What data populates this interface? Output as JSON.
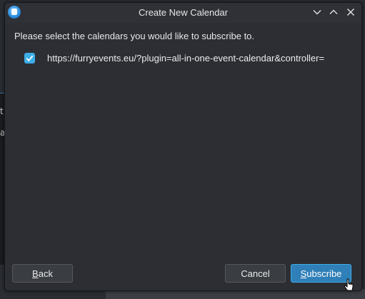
{
  "window": {
    "title": "Create New Calendar"
  },
  "titlebar_buttons": {
    "minimize_icon": "chevron-down-icon",
    "maximize_icon": "chevron-up-icon",
    "close_icon": "close-icon"
  },
  "dialog": {
    "instruction": "Please select the calendars you would like to subscribe to.",
    "calendars": [
      {
        "checked": true,
        "url": "https://furryevents.eu/?plugin=all-in-one-event-calendar&controller="
      }
    ]
  },
  "buttons": {
    "back": {
      "mnemonic": "B",
      "rest": "ack"
    },
    "cancel": "Cancel",
    "subscribe": {
      "mnemonic": "S",
      "rest": "ubscribe"
    }
  },
  "colors": {
    "accent": "#3daee9",
    "primary_button": "#2f7fb8",
    "dialog_bg": "#2c2e33"
  }
}
